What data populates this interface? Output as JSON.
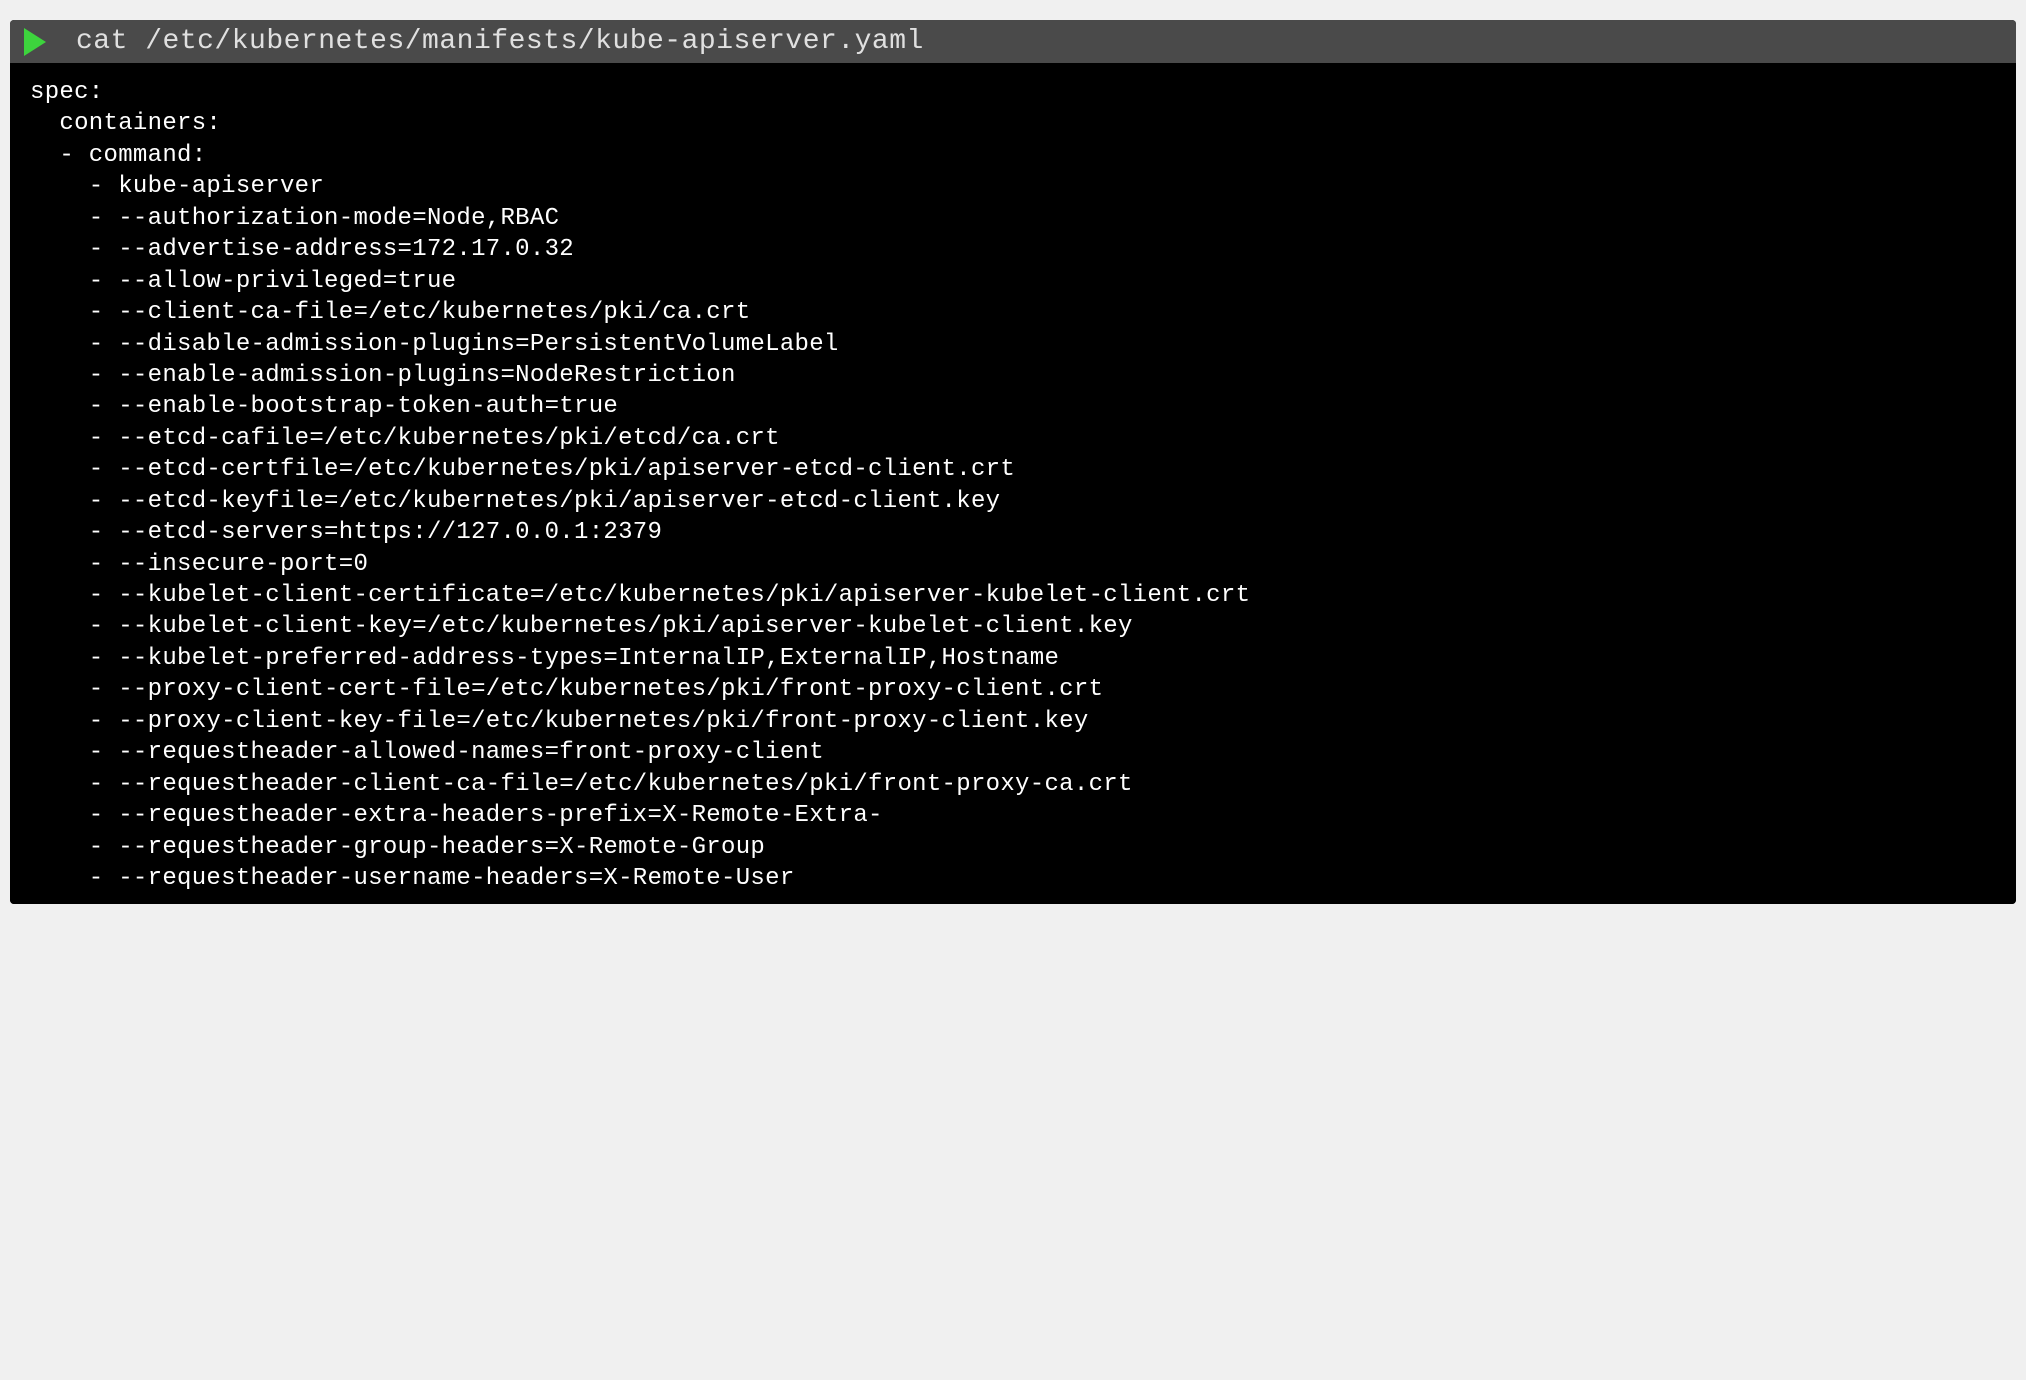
{
  "header": {
    "command": "cat /etc/kubernetes/manifests/kube-apiserver.yaml"
  },
  "yaml": {
    "line0": "spec:",
    "line1": "  containers:",
    "line2": "  - command:",
    "line3": "    - kube-apiserver",
    "line4": "    - --authorization-mode=Node,RBAC",
    "line5": "    - --advertise-address=172.17.0.32",
    "line6": "    - --allow-privileged=true",
    "line7": "    - --client-ca-file=/etc/kubernetes/pki/ca.crt",
    "line8": "    - --disable-admission-plugins=PersistentVolumeLabel",
    "line9": "    - --enable-admission-plugins=NodeRestriction",
    "line10": "    - --enable-bootstrap-token-auth=true",
    "line11": "    - --etcd-cafile=/etc/kubernetes/pki/etcd/ca.crt",
    "line12": "    - --etcd-certfile=/etc/kubernetes/pki/apiserver-etcd-client.crt",
    "line13": "    - --etcd-keyfile=/etc/kubernetes/pki/apiserver-etcd-client.key",
    "line14": "    - --etcd-servers=https://127.0.0.1:2379",
    "line15": "    - --insecure-port=0",
    "line16": "    - --kubelet-client-certificate=/etc/kubernetes/pki/apiserver-kubelet-client.crt",
    "line17": "    - --kubelet-client-key=/etc/kubernetes/pki/apiserver-kubelet-client.key",
    "line18": "    - --kubelet-preferred-address-types=InternalIP,ExternalIP,Hostname",
    "line19": "    - --proxy-client-cert-file=/etc/kubernetes/pki/front-proxy-client.crt",
    "line20": "    - --proxy-client-key-file=/etc/kubernetes/pki/front-proxy-client.key",
    "line21": "    - --requestheader-allowed-names=front-proxy-client",
    "line22": "    - --requestheader-client-ca-file=/etc/kubernetes/pki/front-proxy-ca.crt",
    "line23": "    - --requestheader-extra-headers-prefix=X-Remote-Extra-",
    "line24": "    - --requestheader-group-headers=X-Remote-Group",
    "line25": "    - --requestheader-username-headers=X-Remote-User"
  }
}
